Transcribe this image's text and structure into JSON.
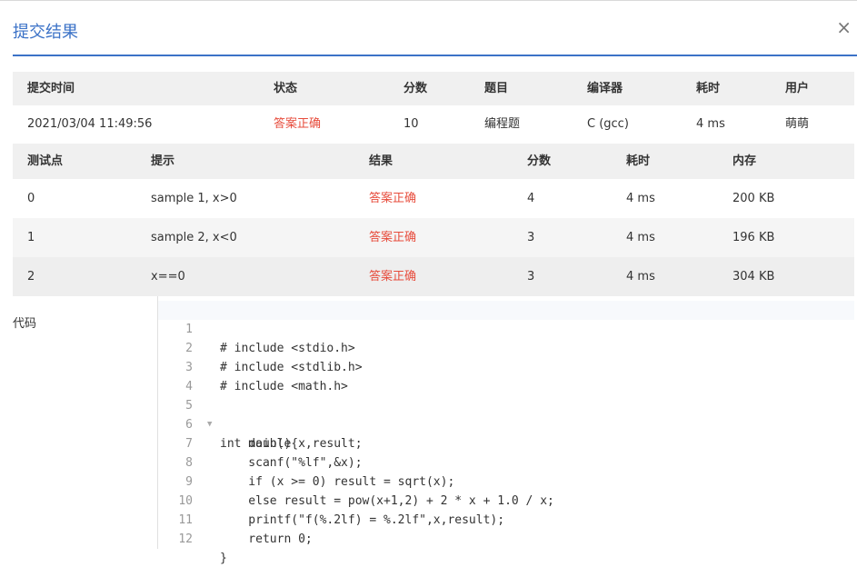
{
  "dialog": {
    "title": "提交结果",
    "close_symbol": "×"
  },
  "summary": {
    "headers": [
      "提交时间",
      "状态",
      "分数",
      "题目",
      "编译器",
      "耗时",
      "用户"
    ],
    "values": [
      "2021/03/04 11:49:56",
      "答案正确",
      "10",
      "编程题",
      "C (gcc)",
      "4 ms",
      "萌萌"
    ]
  },
  "tests": {
    "headers": [
      "测试点",
      "提示",
      "结果",
      "分数",
      "耗时",
      "内存"
    ],
    "rows": [
      [
        "0",
        "sample 1, x>0",
        "答案正确",
        "4",
        "4 ms",
        "200 KB"
      ],
      [
        "1",
        "sample 2, x<0",
        "答案正确",
        "3",
        "4 ms",
        "196 KB"
      ],
      [
        "2",
        "x==0",
        "答案正确",
        "3",
        "4 ms",
        "304 KB"
      ]
    ]
  },
  "code": {
    "label": "代码",
    "lines": [
      "# include <stdio.h>",
      "# include <stdlib.h>",
      "# include <math.h>",
      "",
      "int main(){",
      "    double x,result;",
      "    scanf(\"%lf\",&x);",
      "    if (x >= 0) result = sqrt(x);",
      "    else result = pow(x+1,2) + 2 * x + 1.0 / x;",
      "    printf(\"f(%.2lf) = %.2lf\",x,result);",
      "    return 0;",
      "}"
    ]
  },
  "colors": {
    "accent": "#3b72c7",
    "status_ok": "#e74c3c"
  }
}
